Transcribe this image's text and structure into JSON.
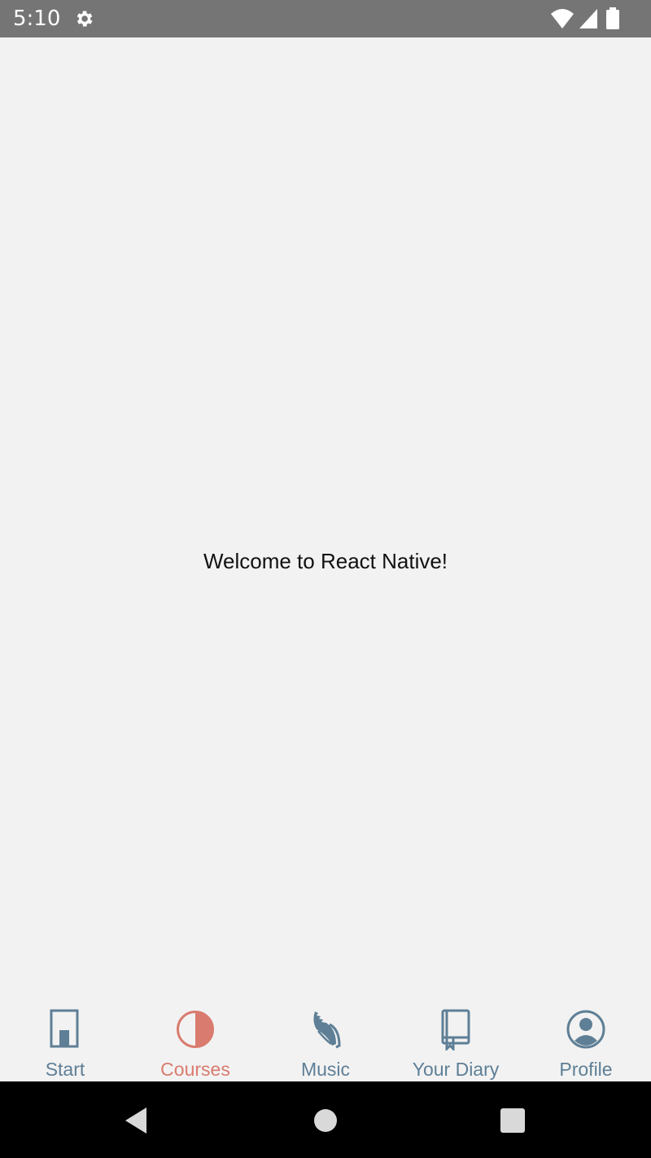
{
  "status_bar": {
    "time": "5:10",
    "icons": [
      "gear-icon",
      "wifi-icon",
      "cell-signal-icon",
      "battery-icon"
    ]
  },
  "main": {
    "welcome_text": "Welcome to React Native!"
  },
  "tabs": [
    {
      "label": "Start",
      "icon": "start-icon",
      "active": false
    },
    {
      "label": "Courses",
      "icon": "half-circle-icon",
      "active": true
    },
    {
      "label": "Music",
      "icon": "shell-icon",
      "active": false
    },
    {
      "label": "Your Diary",
      "icon": "book-icon",
      "active": false
    },
    {
      "label": "Profile",
      "icon": "user-circle-icon",
      "active": false
    }
  ],
  "nav_bar": {
    "buttons": [
      "back-icon",
      "home-icon",
      "recents-icon"
    ]
  },
  "colors": {
    "tab_inactive": "#5e7f96",
    "tab_active": "#d97b6e",
    "status_bar": "#757575",
    "background": "#f2f2f2"
  }
}
